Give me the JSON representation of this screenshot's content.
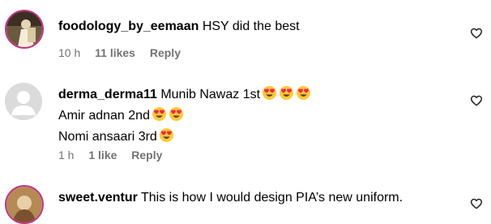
{
  "comments": [
    {
      "username": "foodology_by_eemaan",
      "lines": [
        "HSY did the best"
      ],
      "time": "10 h",
      "likes": "11 likes",
      "reply": "Reply"
    },
    {
      "username": "derma_derma11",
      "lines": [
        "Munib Nawaz 1st",
        "Amir adnan 2nd",
        "Nomi ansaari 3rd"
      ],
      "time": "1 h",
      "likes": "1 like",
      "reply": "Reply"
    },
    {
      "username": "sweet.ventur",
      "lines": [
        "This is how I would design PIA’s new uniform."
      ]
    }
  ],
  "icons": {
    "like": "heart-outline-icon",
    "emoji": "smiling-face-with-heart-eyes"
  }
}
